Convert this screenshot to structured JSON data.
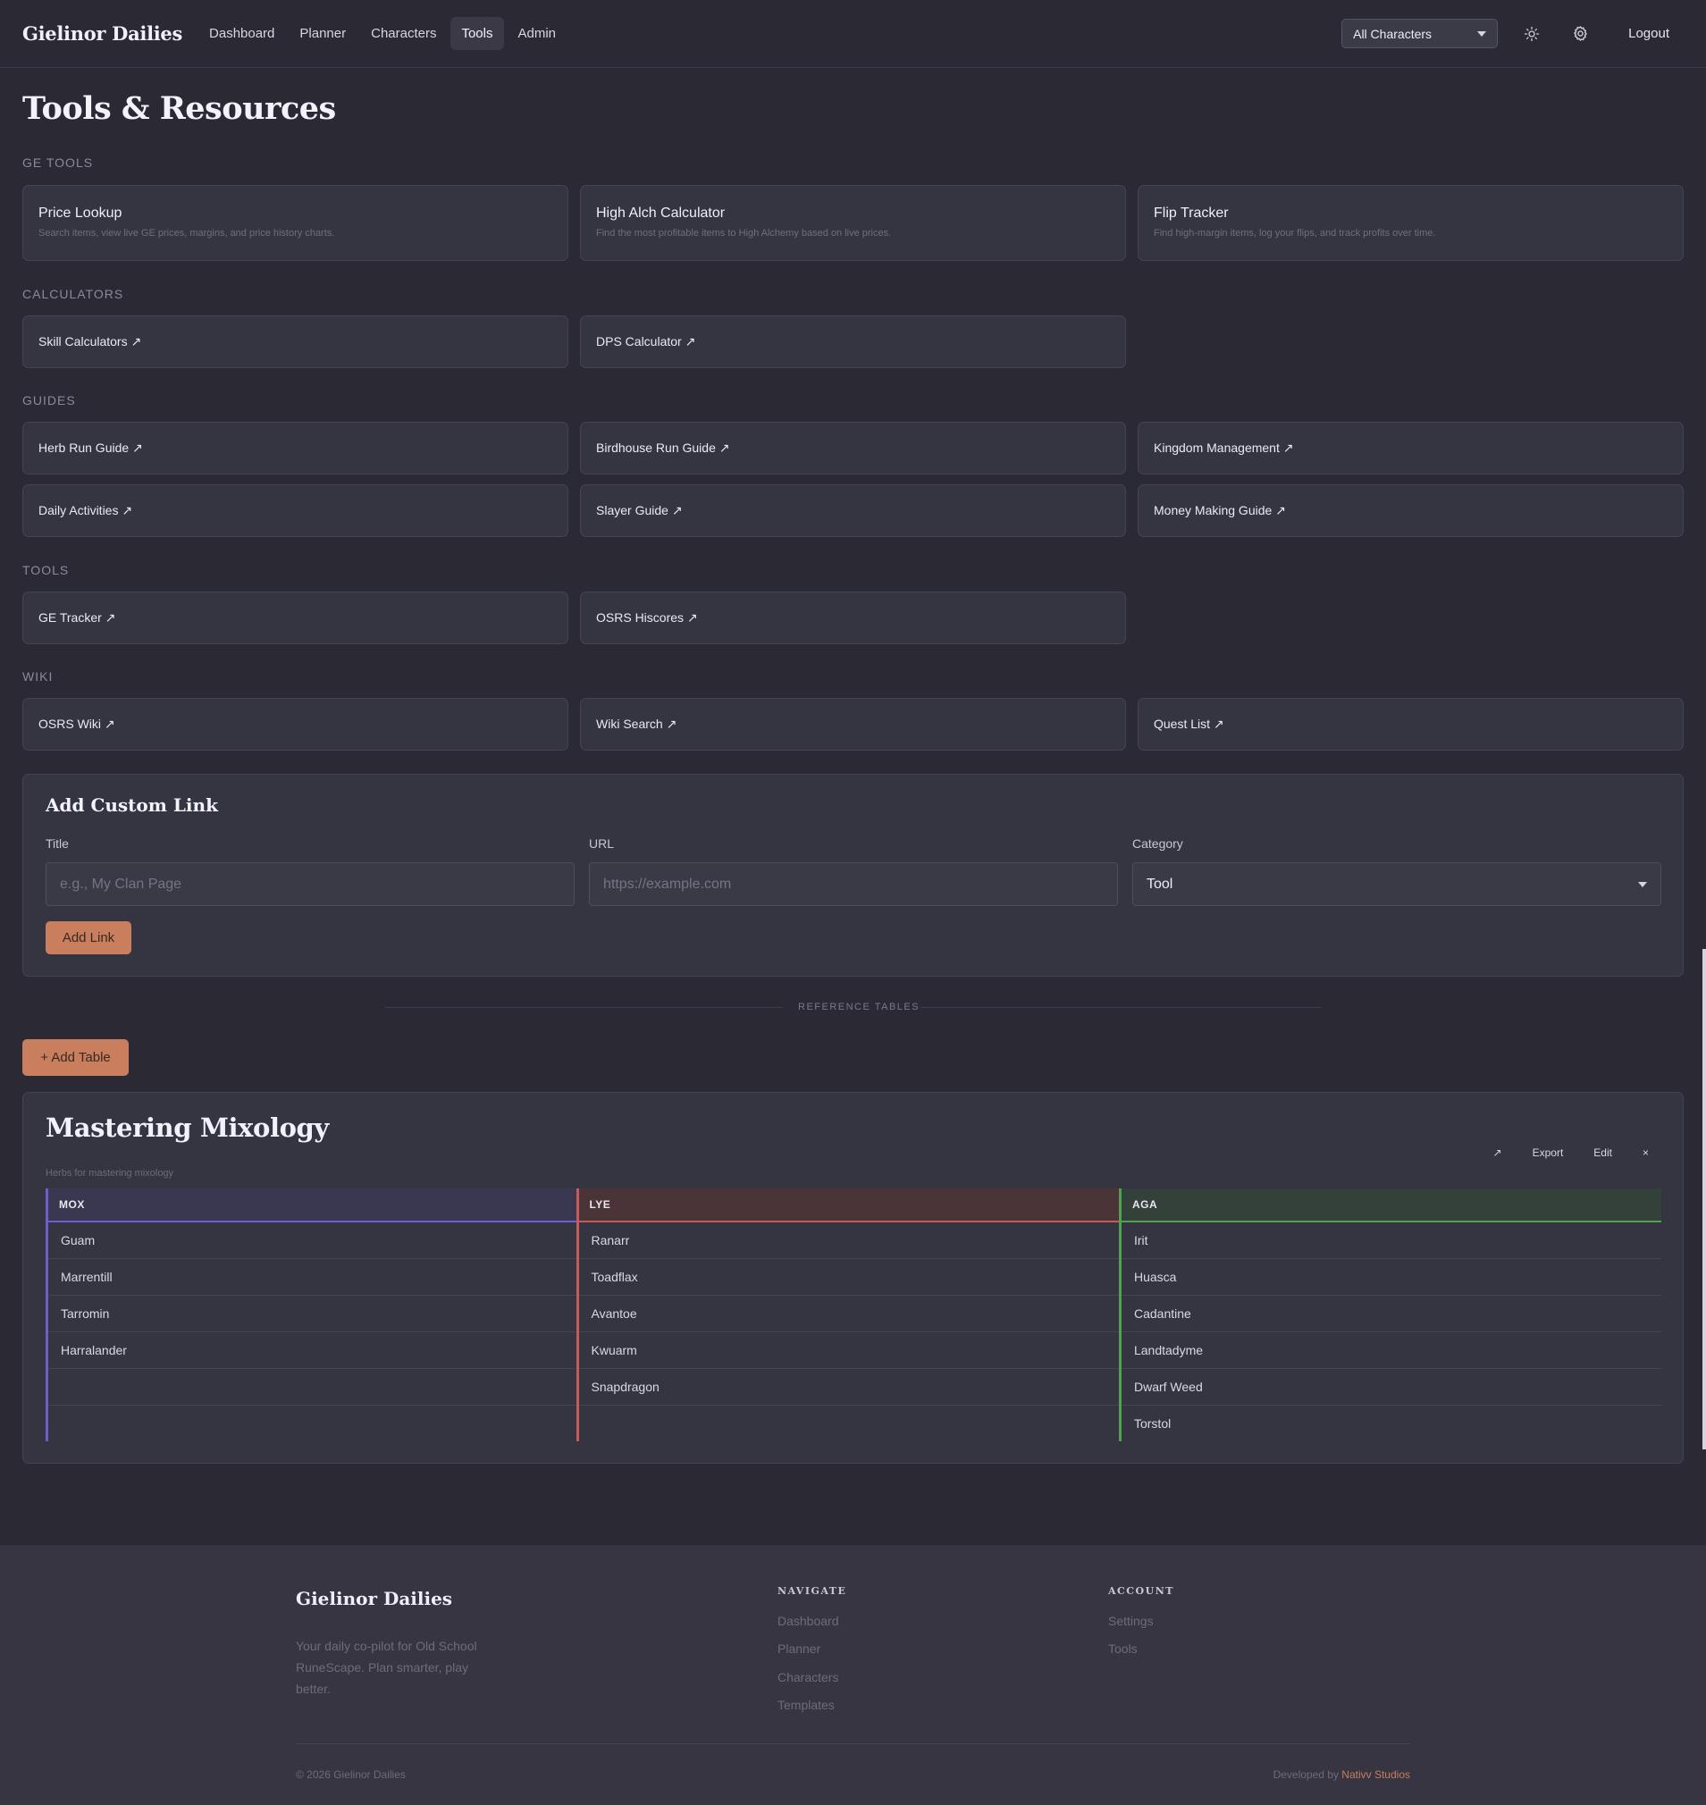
{
  "header": {
    "brand": "Gielinor Dailies",
    "nav": [
      "Dashboard",
      "Planner",
      "Characters",
      "Tools",
      "Admin"
    ],
    "active_nav": "Tools",
    "character_select": "All Characters",
    "logout": "Logout",
    "icons": [
      "sun-icon",
      "gear-icon"
    ]
  },
  "page": {
    "title": "Tools & Resources"
  },
  "ge_tools": {
    "label": "GE TOOLS",
    "cards": [
      {
        "title": "Price Lookup",
        "desc": "Search items, view live GE prices, margins, and price history charts."
      },
      {
        "title": "High Alch Calculator",
        "desc": "Find the most profitable items to High Alchemy based on live prices."
      },
      {
        "title": "Flip Tracker",
        "desc": "Find high-margin items, log your flips, and track profits over time."
      }
    ]
  },
  "calculators": {
    "label": "CALCULATORS",
    "links": [
      "Skill Calculators ↗",
      "DPS Calculator ↗"
    ]
  },
  "guides": {
    "label": "GUIDES",
    "links": [
      "Herb Run Guide ↗",
      "Birdhouse Run Guide ↗",
      "Kingdom Management ↗",
      "Daily Activities ↗",
      "Slayer Guide ↗",
      "Money Making Guide ↗"
    ]
  },
  "tools": {
    "label": "TOOLS",
    "links": [
      "GE Tracker ↗",
      "OSRS Hiscores ↗"
    ]
  },
  "wiki": {
    "label": "WIKI",
    "links": [
      "OSRS Wiki ↗",
      "Wiki Search ↗",
      "Quest List ↗"
    ]
  },
  "custom_link": {
    "title": "Add Custom Link",
    "title_label": "Title",
    "title_placeholder": "e.g., My Clan Page",
    "url_label": "URL",
    "url_placeholder": "https://example.com",
    "category_label": "Category",
    "category_value": "Tool",
    "button": "Add Link"
  },
  "reference": {
    "divider": "REFERENCE TABLES",
    "add_button": "+ Add Table",
    "table": {
      "title": "Mastering Mixology",
      "subtitle": "Herbs for mastering mixology",
      "actions": [
        "↗",
        "Export",
        "Edit",
        "×"
      ],
      "columns": [
        {
          "name": "MOX",
          "color": "#6b5fcf",
          "header_bg": "#3a3850"
        },
        {
          "name": "LYE",
          "color": "#c75a5a",
          "header_bg": "#4a3438"
        },
        {
          "name": "AGA",
          "color": "#4fa34f",
          "header_bg": "#34403a"
        }
      ],
      "rows": [
        [
          "Guam",
          "Ranarr",
          "Irit"
        ],
        [
          "Marrentill",
          "Toadflax",
          "Huasca"
        ],
        [
          "Tarromin",
          "Avantoe",
          "Cadantine"
        ],
        [
          "Harralander",
          "Kwuarm",
          "Landtadyme"
        ],
        [
          "",
          "Snapdragon",
          "Dwarf Weed"
        ],
        [
          "",
          "",
          "Torstol"
        ]
      ]
    }
  },
  "footer": {
    "brand": "Gielinor Dailies",
    "tagline": "Your daily co-pilot for Old School RuneScape. Plan smarter, play better.",
    "navigate_title": "NAVIGATE",
    "navigate": [
      "Dashboard",
      "Planner",
      "Characters",
      "Templates"
    ],
    "account_title": "ACCOUNT",
    "account": [
      "Settings",
      "Tools"
    ],
    "copyright": "© 2026 Gielinor Dailies",
    "developed_by": "Developed by",
    "studio": "Nativv Studios"
  }
}
